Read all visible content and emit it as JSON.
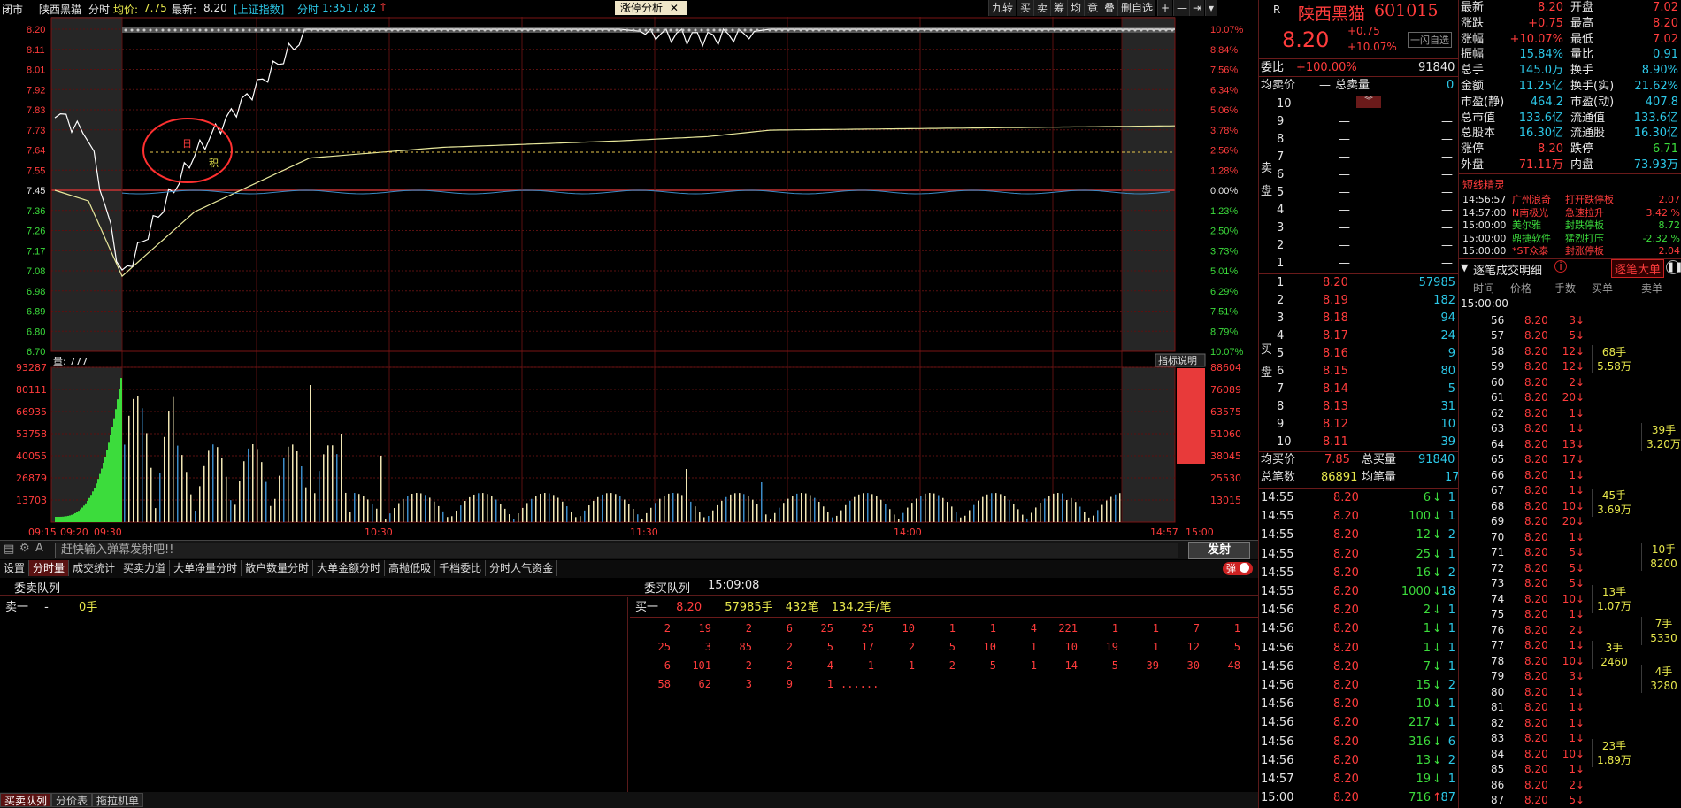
{
  "topbar": {
    "mode": "闭市",
    "stock": "陕西黑猫",
    "view": "分时",
    "avg_label": "均价:",
    "avg_value": "7.75",
    "latest_label": "最新:",
    "latest_value": "8.20",
    "index_name": "[上证指数]",
    "index_label": "分时",
    "index_value": "1:3517.82",
    "center_tab": "涨停分析",
    "tools": [
      "九转",
      "买",
      "卖",
      "筹",
      "均",
      "竟",
      "叠",
      "删自选"
    ]
  },
  "price_axis": {
    "left": [
      "8.20",
      "8.11",
      "8.01",
      "7.92",
      "7.83",
      "7.73",
      "7.64",
      "7.55",
      "7.45",
      "7.36",
      "7.26",
      "7.17",
      "7.08",
      "6.98",
      "6.89",
      "6.80",
      "6.70"
    ],
    "right": [
      "10.07%",
      "8.84%",
      "7.56%",
      "6.34%",
      "5.06%",
      "3.78%",
      "2.56%",
      "1.28%",
      "0.00%",
      "1.23%",
      "2.50%",
      "3.73%",
      "5.01%",
      "6.29%",
      "7.51%",
      "8.79%",
      "10.07%"
    ]
  },
  "volume_axis": {
    "label": "量: 777",
    "indicator_btn": "指标说明",
    "left": [
      "93287",
      "80111",
      "66935",
      "53758",
      "40055",
      "26879",
      "13703"
    ],
    "right": [
      "88604",
      "76089",
      "63575",
      "51060",
      "38045",
      "25530",
      "13015"
    ]
  },
  "time_axis": [
    "09:15",
    "09:20",
    "09:30",
    "10:30",
    "11:30",
    "14:00",
    "14:57",
    "15:00"
  ],
  "markers": {
    "limit_up": "日",
    "event": "积"
  },
  "chart_data": {
    "type": "line",
    "title": "",
    "x": [
      "09:15",
      "09:20",
      "09:30",
      "10:00",
      "10:30",
      "11:00",
      "11:30",
      "13:30",
      "14:00",
      "14:30",
      "15:00"
    ],
    "series": [
      {
        "name": "price",
        "values": [
          7.82,
          7.7,
          7.05,
          7.62,
          8.2,
          8.2,
          8.2,
          8.16,
          8.2,
          8.2,
          8.2
        ]
      },
      {
        "name": "avg",
        "values": [
          7.45,
          7.4,
          7.05,
          7.35,
          7.6,
          7.65,
          7.68,
          7.7,
          7.73,
          7.74,
          7.75
        ]
      }
    ],
    "ylim": [
      6.7,
      8.2
    ],
    "prev_close": 7.45
  },
  "input": {
    "placeholder": "赶快输入弹幕发射吧!!",
    "send": "发射"
  },
  "tabs": [
    "设置",
    "分时量",
    "成交统计",
    "买卖力道",
    "大单净量分时",
    "散户数量分时",
    "大单金额分时",
    "高抛低吸",
    "千档委比",
    "分时人气资金"
  ],
  "toggle": "弹",
  "queue": {
    "left_title": "委卖队列",
    "right_title": "委买队列",
    "time": "15:09:08",
    "sell_label": "卖一",
    "sell_dash": "-",
    "sell_qty": "0手",
    "buy_label": "买一",
    "buy_price": "8.20",
    "buy_qty": "57985手",
    "buy_count": "432笔",
    "buy_avg": "134.2手/笔",
    "rows": [
      [
        "2",
        "19",
        "2",
        "6",
        "25",
        "25",
        "10",
        "1",
        "1",
        "4",
        "221",
        "1",
        "1",
        "7",
        "1"
      ],
      [
        "25",
        "3",
        "85",
        "2",
        "5",
        "17",
        "2",
        "5",
        "10",
        "1",
        "10",
        "19",
        "1",
        "12",
        "5"
      ],
      [
        "6",
        "101",
        "2",
        "2",
        "4",
        "1",
        "1",
        "2",
        "5",
        "1",
        "14",
        "5",
        "39",
        "30",
        "48"
      ],
      [
        "58",
        "62",
        "3",
        "9",
        "1",
        "......"
      ]
    ]
  },
  "bottom_tabs": [
    "买卖队列",
    "分价表",
    "拖拉机单"
  ],
  "quote": {
    "flag": "R",
    "name": "陕西黑猫",
    "code": "601015",
    "price": "8.20",
    "change": "+0.75",
    "pct": "+10.07%",
    "btn": "一闪自选",
    "weibi_label": "委比",
    "weibi": "+100.00%",
    "weicha": "91840",
    "avg_sell_label": "均卖价",
    "avg_sell": "—",
    "total_sell_label": "总卖量",
    "total_sell": "0",
    "sell_levels": [
      "10",
      "9",
      "8",
      "7",
      "6",
      "5",
      "4",
      "3",
      "2",
      "1"
    ],
    "sell_dash": "—",
    "buy": [
      [
        "1",
        "8.20",
        "57985"
      ],
      [
        "2",
        "8.19",
        "182"
      ],
      [
        "3",
        "8.18",
        "94"
      ],
      [
        "4",
        "8.17",
        "24"
      ],
      [
        "5",
        "8.16",
        "9"
      ],
      [
        "6",
        "8.15",
        "80"
      ],
      [
        "7",
        "8.14",
        "5"
      ],
      [
        "8",
        "8.13",
        "31"
      ],
      [
        "9",
        "8.12",
        "10"
      ],
      [
        "10",
        "8.11",
        "39"
      ]
    ],
    "sell_side": "卖盘",
    "buy_side": "买盘",
    "avg_buy_label": "均买价",
    "avg_buy": "7.85",
    "total_buy_label": "总买量",
    "total_buy": "91840",
    "total_trades_label": "总笔数",
    "total_trades": "86891",
    "avg_vol_label": "均笔量",
    "avg_vol": "17"
  },
  "ticks": [
    [
      "14:55",
      "8.20",
      "6",
      "1"
    ],
    [
      "14:55",
      "8.20",
      "100",
      "1"
    ],
    [
      "14:55",
      "8.20",
      "12",
      "2"
    ],
    [
      "14:55",
      "8.20",
      "25",
      "1"
    ],
    [
      "14:55",
      "8.20",
      "16",
      "2"
    ],
    [
      "14:55",
      "8.20",
      "1000",
      "18"
    ],
    [
      "14:56",
      "8.20",
      "2",
      "1"
    ],
    [
      "14:56",
      "8.20",
      "1",
      "1"
    ],
    [
      "14:56",
      "8.20",
      "1",
      "1"
    ],
    [
      "14:56",
      "8.20",
      "7",
      "1"
    ],
    [
      "14:56",
      "8.20",
      "15",
      "2"
    ],
    [
      "14:56",
      "8.20",
      "10",
      "1"
    ],
    [
      "14:56",
      "8.20",
      "217",
      "1"
    ],
    [
      "14:56",
      "8.20",
      "316",
      "6"
    ],
    [
      "14:56",
      "8.20",
      "13",
      "2"
    ],
    [
      "14:57",
      "8.20",
      "19",
      "1"
    ],
    [
      "15:00",
      "8.20",
      "716",
      "87"
    ]
  ],
  "stats": [
    [
      "最新",
      "8.20",
      "开盘",
      "7.02"
    ],
    [
      "涨跌",
      "+0.75",
      "最高",
      "8.20"
    ],
    [
      "涨幅",
      "+10.07%",
      "最低",
      "7.02"
    ],
    [
      "振幅",
      "15.84%",
      "量比",
      "0.91"
    ],
    [
      "总手",
      "145.0万",
      "换手",
      "8.90%"
    ],
    [
      "金额",
      "11.25亿",
      "换手(实)",
      "21.62%"
    ],
    [
      "市盈(静)",
      "464.2",
      "市盈(动)",
      "407.8"
    ],
    [
      "总市值",
      "133.6亿",
      "流通值",
      "133.6亿"
    ],
    [
      "总股本",
      "16.30亿",
      "流通股",
      "16.30亿"
    ],
    [
      "涨停",
      "8.20",
      "跌停",
      "6.71"
    ],
    [
      "外盘",
      "71.11万",
      "内盘",
      "73.93万"
    ]
  ],
  "sprite": {
    "title": "短线精灵",
    "rows": [
      [
        "14:56:57",
        "广州浪奇",
        "打开跌停板",
        "2.07"
      ],
      [
        "14:57:00",
        "N南极光",
        "急速拉升",
        "3.42 %"
      ],
      [
        "15:00:00",
        "美尔雅",
        "封跌停板",
        "8.72"
      ],
      [
        "15:00:00",
        "鼎捷软件",
        "猛烈打压",
        "-2.32 %"
      ],
      [
        "15:00:00",
        "*ST众泰",
        "封涨停板",
        "2.04"
      ]
    ]
  },
  "detail": {
    "title": "逐笔成交明细",
    "btn": "逐笔大单",
    "headers": [
      "时间",
      "价格",
      "手数",
      "买单",
      "卖单"
    ],
    "first_time": "15:00:00",
    "rows": [
      [
        "56",
        "8.20",
        "3"
      ],
      [
        "57",
        "8.20",
        "5"
      ],
      [
        "58",
        "8.20",
        "12"
      ],
      [
        "59",
        "8.20",
        "12"
      ],
      [
        "60",
        "8.20",
        "2"
      ],
      [
        "61",
        "8.20",
        "20"
      ],
      [
        "62",
        "8.20",
        "1"
      ],
      [
        "63",
        "8.20",
        "1"
      ],
      [
        "64",
        "8.20",
        "13"
      ],
      [
        "65",
        "8.20",
        "17"
      ],
      [
        "66",
        "8.20",
        "1"
      ],
      [
        "67",
        "8.20",
        "1"
      ],
      [
        "68",
        "8.20",
        "10"
      ],
      [
        "69",
        "8.20",
        "20"
      ],
      [
        "70",
        "8.20",
        "1"
      ],
      [
        "71",
        "8.20",
        "5"
      ],
      [
        "72",
        "8.20",
        "5"
      ],
      [
        "73",
        "8.20",
        "5"
      ],
      [
        "74",
        "8.20",
        "10"
      ],
      [
        "75",
        "8.20",
        "1"
      ],
      [
        "76",
        "8.20",
        "2"
      ],
      [
        "77",
        "8.20",
        "1"
      ],
      [
        "78",
        "8.20",
        "10"
      ],
      [
        "79",
        "8.20",
        "3"
      ],
      [
        "80",
        "8.20",
        "1"
      ],
      [
        "81",
        "8.20",
        "1"
      ],
      [
        "82",
        "8.20",
        "1"
      ],
      [
        "83",
        "8.20",
        "1"
      ],
      [
        "84",
        "8.20",
        "10"
      ],
      [
        "85",
        "8.20",
        "1"
      ],
      [
        "86",
        "8.20",
        "2"
      ],
      [
        "87",
        "8.20",
        "5"
      ]
    ],
    "groups": [
      [
        "68手",
        "5.58万"
      ],
      [
        "39手",
        "3.20万"
      ],
      [
        "45手",
        "3.69万"
      ],
      [
        "10手",
        "8200"
      ],
      [
        "13手",
        "1.07万"
      ],
      [
        "7手",
        "5330"
      ],
      [
        "3手",
        "2460"
      ],
      [
        "4手",
        "3280"
      ],
      [
        "23手",
        "1.89万"
      ]
    ]
  },
  "colors": {
    "up": "#ff3c3c",
    "down": "#3cdc3c",
    "grid": "#7a1414",
    "price_line": "#ffffff",
    "avg_line": "#e8e89c",
    "volume_up": "#f0e6b4",
    "volume_down": "#3cdc3c"
  }
}
